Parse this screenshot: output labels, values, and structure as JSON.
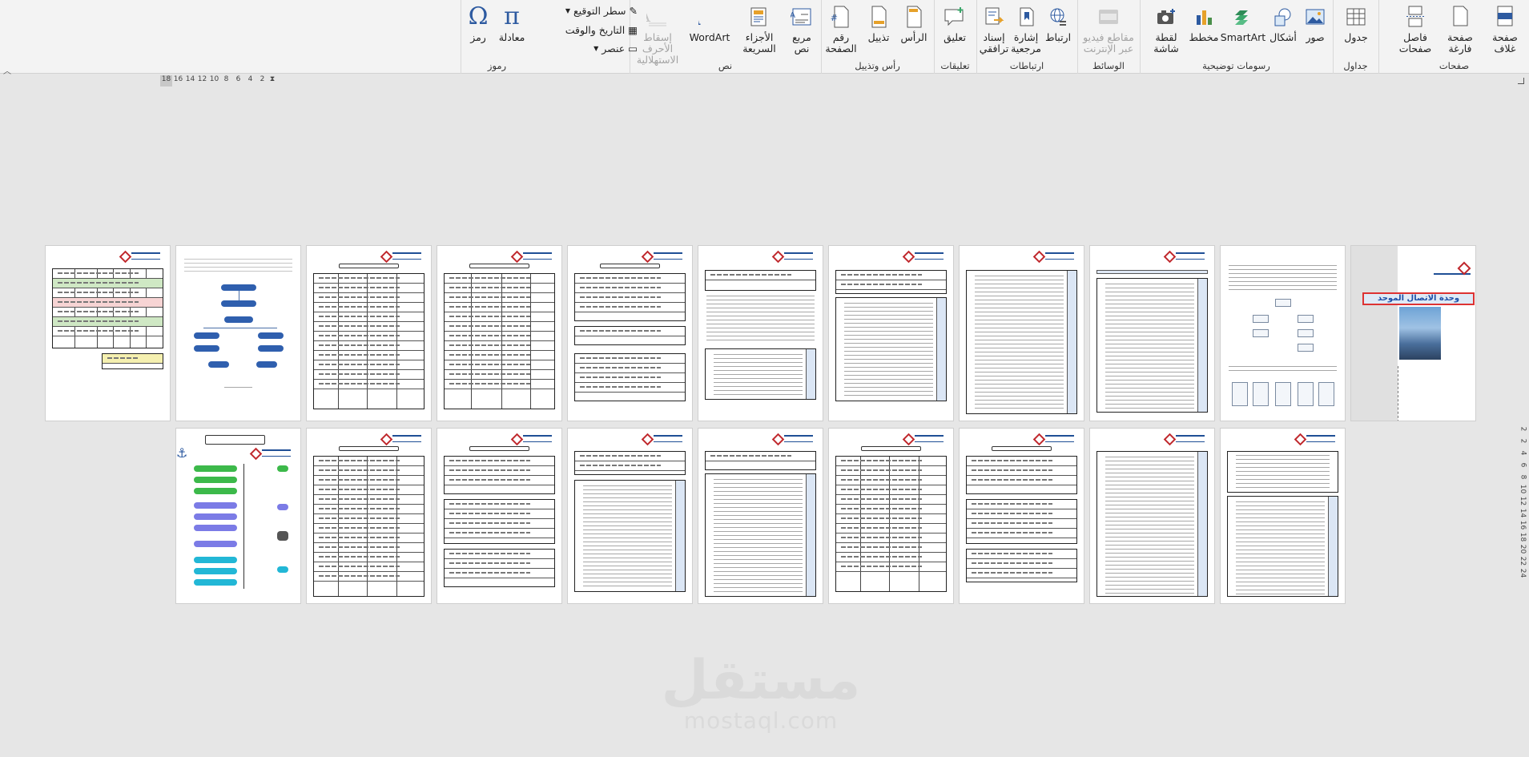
{
  "ribbon": {
    "groups": {
      "pages": {
        "label": "صفحات",
        "cover": "صفحة\nغلاف",
        "blank": "صفحة\nفارغة",
        "break": "فاصل\nصفحات"
      },
      "tables": {
        "label": "جداول",
        "table": "جدول"
      },
      "illustrations": {
        "label": "رسومات توضيحية",
        "pictures": "صور",
        "shapes": "أشكال",
        "smartart": "SmartArt",
        "chart": "مخطط",
        "screenshot": "لقطة\nشاشة"
      },
      "media": {
        "label": "الوسائط",
        "online_video": "مقاطع فيديو\nعبر الإنترنت"
      },
      "links": {
        "label": "ارتباطات",
        "link": "ارتباط",
        "bookmark": "إشارة\nمرجعية",
        "cross_ref": "إسناد\nترافقي"
      },
      "comments": {
        "label": "تعليقات",
        "comment": "تعليق"
      },
      "header_footer": {
        "label": "رأس وتذييل",
        "header": "الرأس",
        "footer": "تذييل",
        "page_number": "رقم\nالصفحة"
      },
      "text": {
        "label": "نص",
        "textbox": "مربع\nنص",
        "quick_parts": "الأجزاء\nالسريعة",
        "wordart": "WordArt",
        "dropcap": "إسقاط الأحرف\nالاستهلالية",
        "signature_line": "سطر التوقيع",
        "date_time": "التاريخ والوقت",
        "object": "عنصر"
      },
      "symbols": {
        "label": "رموز",
        "equation": "معادلة",
        "symbol": "رمز"
      }
    }
  },
  "ruler": {
    "horizontal": [
      "18",
      "16",
      "14",
      "12",
      "10",
      "8",
      "6",
      "4",
      "2"
    ],
    "vertical": [
      "2",
      "2",
      "4",
      "6",
      "8",
      "10",
      "12",
      "14",
      "16",
      "18",
      "20",
      "22",
      "24"
    ]
  },
  "cover": {
    "title": "وحدة الاتصال الموحد"
  },
  "watermark": {
    "arabic": "مستقل",
    "latin": "mostaql.com"
  }
}
